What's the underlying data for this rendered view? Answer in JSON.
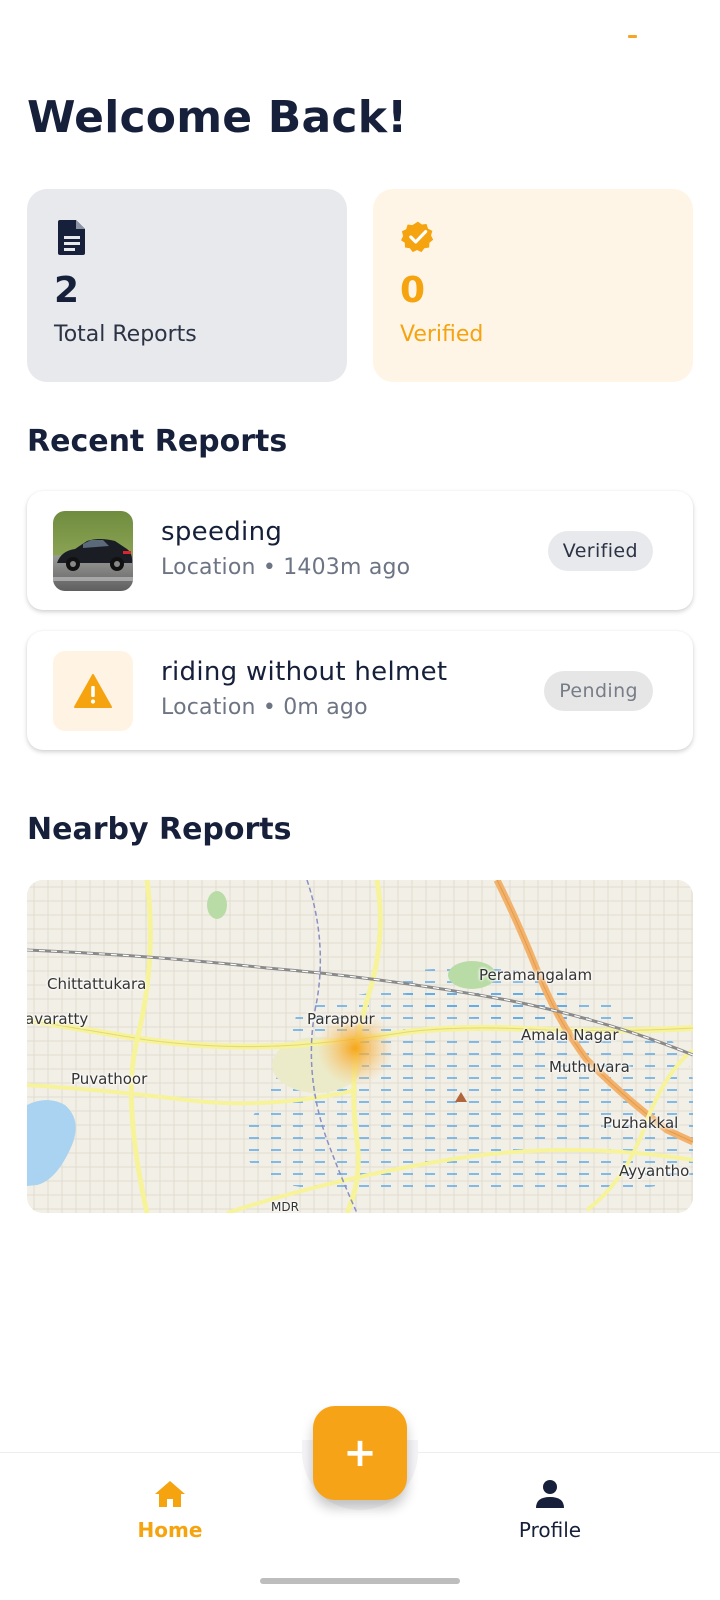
{
  "header": {
    "title": "Welcome Back!"
  },
  "stats": {
    "total": {
      "value": "2",
      "label": "Total Reports",
      "icon": "document-icon"
    },
    "verified": {
      "value": "0",
      "label": "Verified",
      "icon": "verified-badge-icon"
    }
  },
  "recent": {
    "title": "Recent Reports",
    "items": [
      {
        "title": "speeding",
        "meta": "Location • 1403m ago",
        "status": "Verified",
        "thumb": "car-photo"
      },
      {
        "title": "riding without helmet",
        "meta": "Location • 0m ago",
        "status": "Pending",
        "thumb": "warning-icon"
      }
    ]
  },
  "nearby": {
    "title": "Nearby Reports",
    "map_labels": {
      "chittattukara": "Chittattukara",
      "avaratty": "avaratty",
      "puvathoor": "Puvathoor",
      "parappur": "Parappur",
      "peramangalam": "Peramangalam",
      "amala_nagar": "Amala Nagar",
      "muthuvara": "Muthuvara",
      "puzhakkal": "Puzhakkal",
      "ayyanthole": "Ayyantho",
      "mdr": "MDR"
    }
  },
  "nav": {
    "home": "Home",
    "profile": "Profile",
    "fab": "+"
  },
  "colors": {
    "accent": "#f5a30f",
    "dark": "#16203a",
    "muted": "#6d7483"
  }
}
